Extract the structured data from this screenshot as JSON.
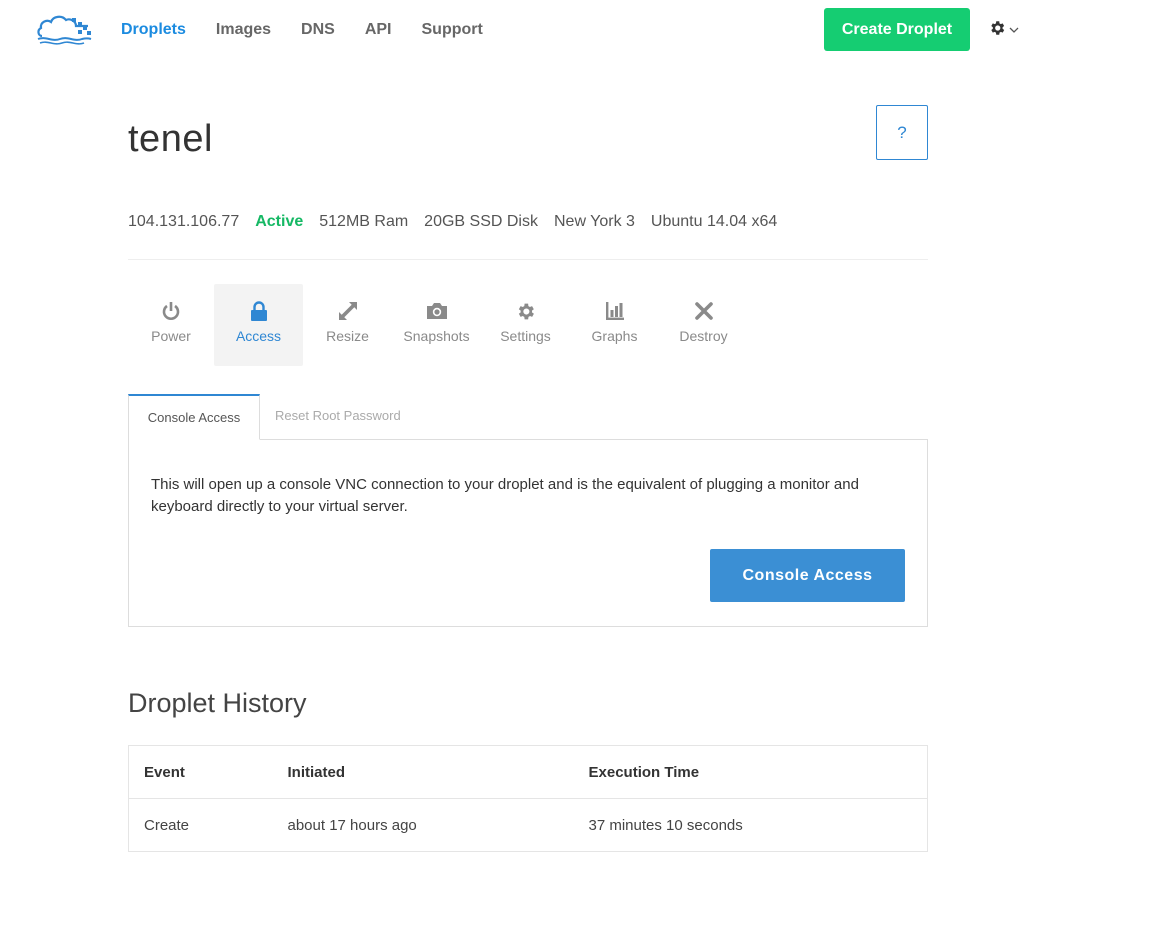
{
  "nav": {
    "links": [
      {
        "label": "Droplets",
        "active": true
      },
      {
        "label": "Images",
        "active": false
      },
      {
        "label": "DNS",
        "active": false
      },
      {
        "label": "API",
        "active": false
      },
      {
        "label": "Support",
        "active": false
      }
    ],
    "create_label": "Create Droplet"
  },
  "droplet": {
    "name": "tenel",
    "help_label": "?",
    "ip": "104.131.106.77",
    "status": "Active",
    "ram": "512MB Ram",
    "disk": "20GB SSD Disk",
    "region": "New York 3",
    "os": "Ubuntu 14.04 x64"
  },
  "actions": [
    {
      "label": "Power",
      "icon": "power-icon"
    },
    {
      "label": "Access",
      "icon": "lock-icon",
      "active": true
    },
    {
      "label": "Resize",
      "icon": "resize-icon"
    },
    {
      "label": "Snapshots",
      "icon": "camera-icon"
    },
    {
      "label": "Settings",
      "icon": "gear-icon"
    },
    {
      "label": "Graphs",
      "icon": "bar-chart-icon"
    },
    {
      "label": "Destroy",
      "icon": "close-icon"
    }
  ],
  "subtabs": {
    "console_access": "Console Access",
    "reset_root": "Reset Root Password"
  },
  "panel": {
    "description": "This will open up a console VNC connection to your droplet and is the equivalent of plugging a monitor and keyboard directly to your virtual server.",
    "button_label": "Console Access"
  },
  "history": {
    "title": "Droplet History",
    "headers": [
      "Event",
      "Initiated",
      "Execution Time"
    ],
    "rows": [
      [
        "Create",
        "about 17 hours ago",
        "37 minutes 10 seconds"
      ]
    ]
  },
  "colors": {
    "accent": "#2f87d3",
    "nav_active": "#1b8be0",
    "create_button": "#15cd72",
    "status_active": "#15b864",
    "console_button": "#3b8fd4"
  }
}
